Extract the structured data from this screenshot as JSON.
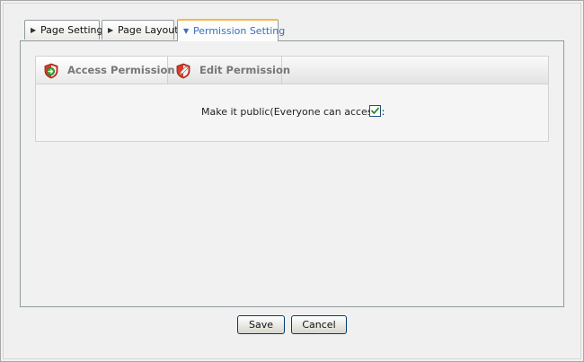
{
  "tabs": [
    {
      "label": "Page Setting",
      "active": false
    },
    {
      "label": "Page Layout",
      "active": false
    },
    {
      "label": "Permission Setting",
      "active": true
    }
  ],
  "subtabs": [
    {
      "label": "Access Permission",
      "icon": "shield-arrow-icon",
      "active": true
    },
    {
      "label": "Edit Permission",
      "icon": "shield-pencil-icon",
      "active": false
    }
  ],
  "access": {
    "make_public_label": "Make it public(Everyone can access):",
    "make_public_checked": true
  },
  "buttons": {
    "save": "Save",
    "cancel": "Cancel"
  },
  "colors": {
    "active_tab_text": "#3a6fbf",
    "active_tab_top": "#f7b64b",
    "check_green": "#2e8b2e"
  }
}
